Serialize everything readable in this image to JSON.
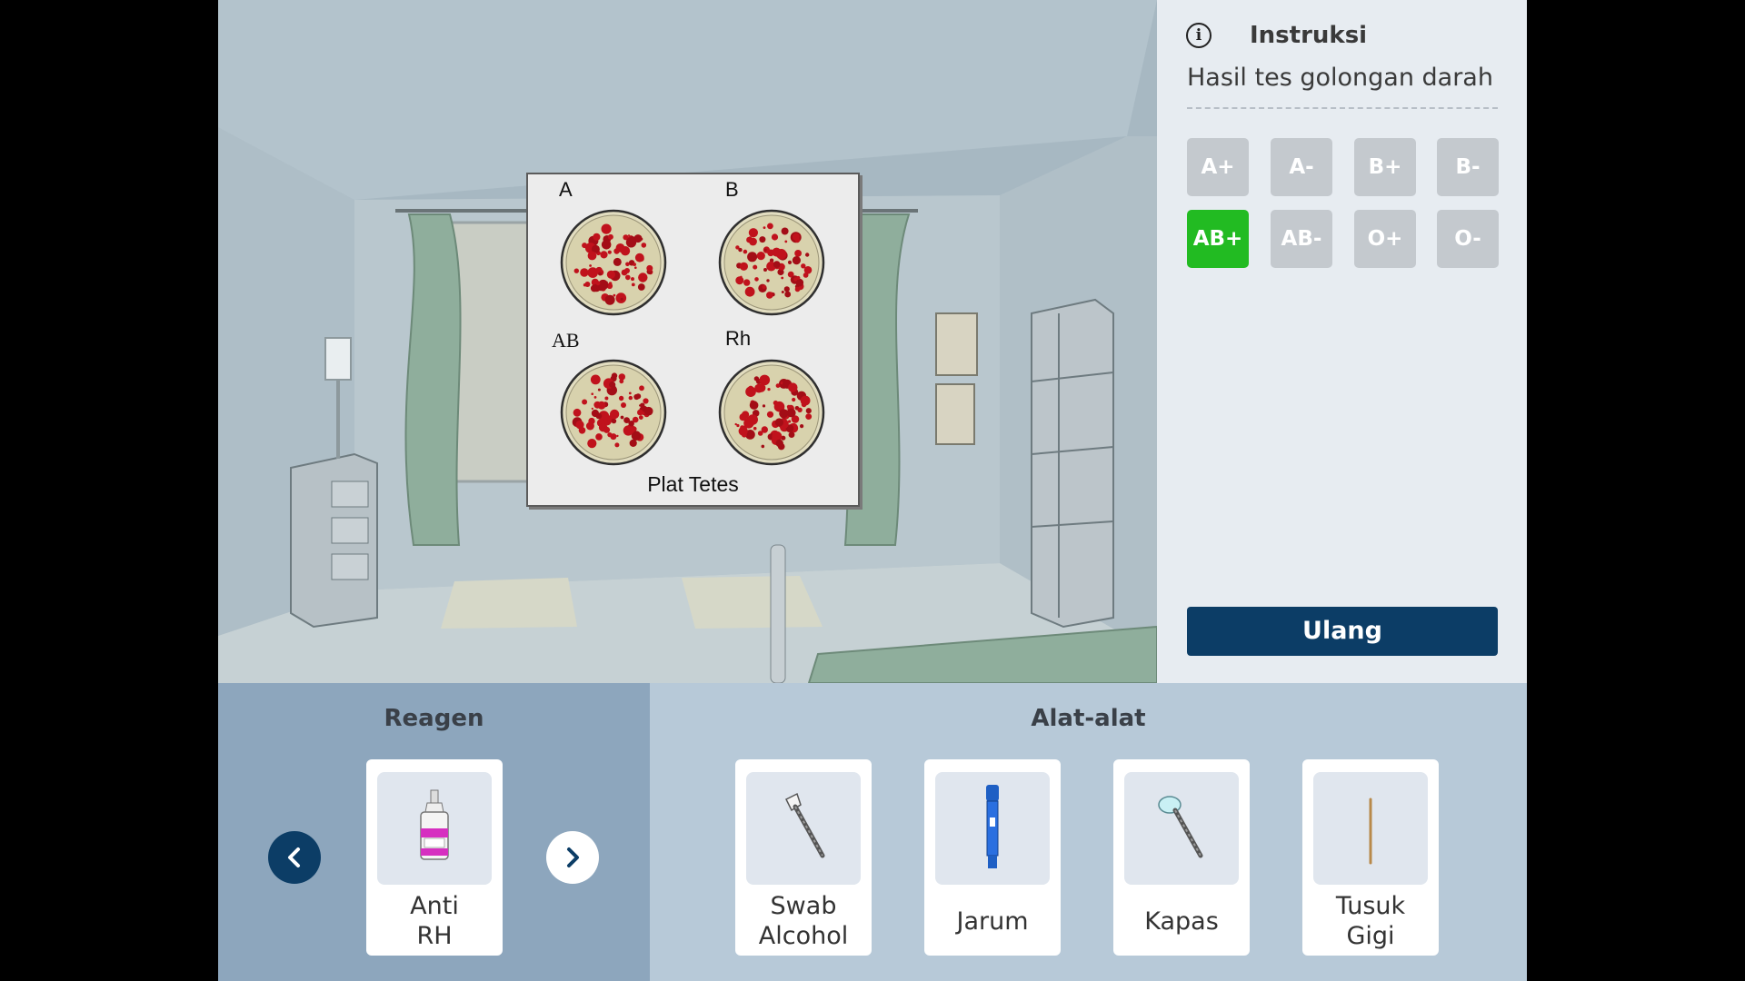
{
  "plate": {
    "title": "Plat Tetes",
    "wells": [
      {
        "label": "A"
      },
      {
        "label": "B"
      },
      {
        "label": "AB"
      },
      {
        "label": "Rh"
      }
    ]
  },
  "instruction": {
    "title": "Instruksi",
    "subtitle": "Hasil tes golongan darah",
    "blood_types": [
      "A+",
      "A-",
      "B+",
      "B-",
      "AB+",
      "AB-",
      "O+",
      "O-"
    ],
    "selected": "AB+",
    "reset_label": "Ulang"
  },
  "reagents": {
    "title": "Reagen",
    "items": [
      {
        "label": "Anti\nRH",
        "icon": "reagent-bottle-icon"
      }
    ]
  },
  "tools": {
    "title": "Alat-alat",
    "items": [
      {
        "label": "Swab\nAlcohol",
        "icon": "alcohol-swab-icon"
      },
      {
        "label": "Jarum",
        "icon": "lancet-needle-icon"
      },
      {
        "label": "Kapas",
        "icon": "cotton-swab-icon"
      },
      {
        "label": "Tusuk\nGigi",
        "icon": "toothpick-icon"
      }
    ]
  },
  "colors": {
    "selected": "#22bb22",
    "primary": "#0c3d66",
    "blood": "#c0121c"
  }
}
